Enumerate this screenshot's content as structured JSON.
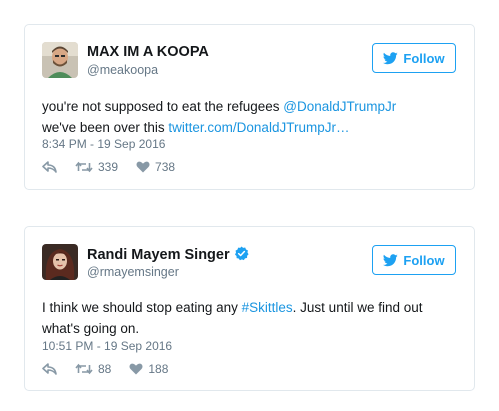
{
  "colors": {
    "accent": "#1da1f2",
    "link": "#1b95e0",
    "text_primary": "#14171a",
    "text_secondary": "#657786",
    "border": "#e1e8ed"
  },
  "tweets": [
    {
      "display_name": "MAX IM A KOOPA",
      "handle": "@meakoopa",
      "verified": false,
      "follow_label": "Follow",
      "text_line1_prefix": "you're not supposed to eat the refugees ",
      "text_line1_mention": "@DonaldJTrumpJr",
      "text_line2_prefix": "we've been over this ",
      "text_line2_link": "twitter.com/DonaldJTrumpJr…",
      "timestamp": "8:34 PM - 19 Sep 2016",
      "retweets": "339",
      "likes": "738",
      "icons": [
        "reply-icon",
        "retweet-icon",
        "heart-icon",
        "twitter-bird-icon"
      ]
    },
    {
      "display_name": "Randi Mayem Singer",
      "handle": "@rmayemsinger",
      "verified": true,
      "follow_label": "Follow",
      "text_line1_prefix": "I think we should stop eating any ",
      "text_line1_hashtag": "#Skittles",
      "text_line1_suffix": ". Just until we find out",
      "text_line2": "what's going on.",
      "timestamp": "10:51 PM - 19 Sep 2016",
      "retweets": "88",
      "likes": "188",
      "icons": [
        "reply-icon",
        "retweet-icon",
        "heart-icon",
        "twitter-bird-icon",
        "verified-badge-icon"
      ]
    }
  ]
}
